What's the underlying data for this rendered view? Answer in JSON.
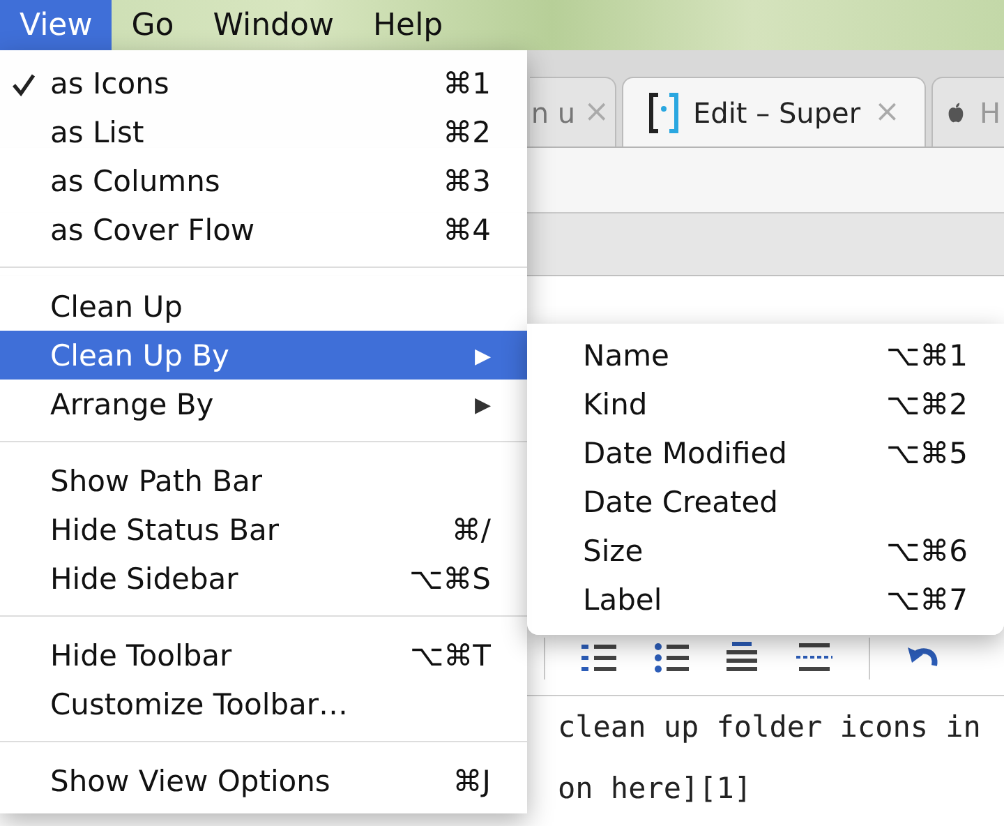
{
  "menubar": [
    {
      "label": "View",
      "selected": true
    },
    {
      "label": "Go",
      "selected": false
    },
    {
      "label": "Window",
      "selected": false
    },
    {
      "label": "Help",
      "selected": false
    }
  ],
  "browser": {
    "tabs": [
      {
        "title": "n u",
        "close": "×",
        "selected": false
      },
      {
        "title": "Edit – Super",
        "close": "×",
        "selected": true
      },
      {
        "title": "H",
        "selected": false
      }
    ],
    "editor_text": [
      "clean up folder icons in",
      "on here][1]"
    ]
  },
  "view_menu": {
    "sections": [
      {
        "items": [
          {
            "label": "as Icons",
            "shortcut": "⌘1",
            "checked": true,
            "selected": false
          },
          {
            "label": "as List",
            "shortcut": "⌘2",
            "checked": false,
            "selected": false
          },
          {
            "label": "as Columns",
            "shortcut": "⌘3",
            "checked": false,
            "selected": false
          },
          {
            "label": "as Cover Flow",
            "shortcut": "⌘4",
            "checked": false,
            "selected": false
          }
        ]
      },
      {
        "items": [
          {
            "label": "Clean Up",
            "checked": false,
            "selected": false
          },
          {
            "label": "Clean Up By",
            "arrow": "▶",
            "checked": false,
            "selected": true
          },
          {
            "label": "Arrange By",
            "arrow": "▶",
            "checked": false,
            "selected": false
          }
        ]
      },
      {
        "items": [
          {
            "label": "Show Path Bar",
            "checked": false,
            "selected": false
          },
          {
            "label": "Hide Status Bar",
            "shortcut": "⌘/",
            "checked": false,
            "selected": false
          },
          {
            "label": "Hide Sidebar",
            "shortcut": "⌥⌘S",
            "checked": false,
            "selected": false
          }
        ]
      },
      {
        "items": [
          {
            "label": "Hide Toolbar",
            "shortcut": "⌥⌘T",
            "checked": false,
            "selected": false
          },
          {
            "label": "Customize Toolbar…",
            "checked": false,
            "selected": false
          }
        ]
      },
      {
        "items": [
          {
            "label": "Show View Options",
            "shortcut": "⌘J",
            "checked": false,
            "selected": false
          }
        ]
      }
    ]
  },
  "submenu": {
    "sections": [
      {
        "items": [
          {
            "label": "Name",
            "shortcut": "⌥⌘1",
            "selected": false
          },
          {
            "label": "Kind",
            "shortcut": "⌥⌘2",
            "selected": false
          },
          {
            "label": "Date Modified",
            "shortcut": "⌥⌘5",
            "selected": false
          },
          {
            "label": "Date Created",
            "selected": false
          },
          {
            "label": "Size",
            "shortcut": "⌥⌘6",
            "selected": false
          },
          {
            "label": "Label",
            "shortcut": "⌥⌘7",
            "selected": false
          }
        ]
      }
    ]
  }
}
